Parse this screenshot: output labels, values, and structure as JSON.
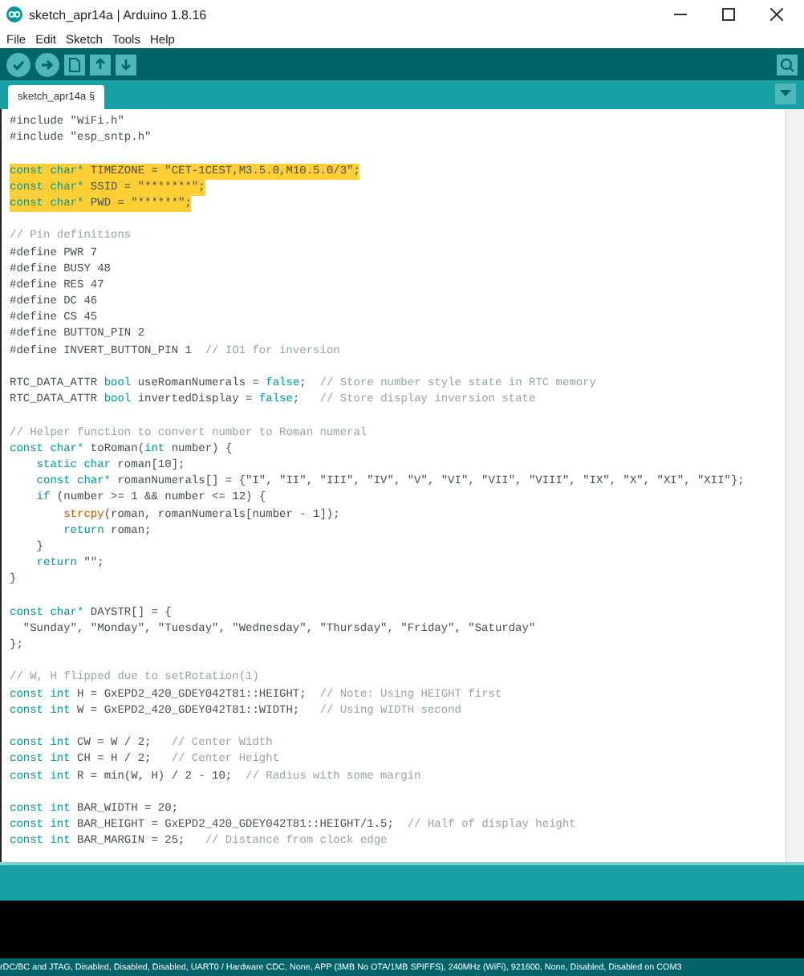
{
  "window": {
    "title": "sketch_apr14a | Arduino 1.8.16"
  },
  "menu": [
    "File",
    "Edit",
    "Sketch",
    "Tools",
    "Help"
  ],
  "tabs": [
    {
      "label": "sketch_apr14a §",
      "selected": true
    }
  ],
  "editor": {
    "lines": [
      {
        "kind": "code",
        "highlighted": false,
        "tokens": [
          {
            "kind": "plain",
            "text": "#include \"WiFi.h\""
          }
        ]
      },
      {
        "kind": "code",
        "highlighted": false,
        "tokens": [
          {
            "kind": "plain",
            "text": "#include \"esp_sntp.h\""
          }
        ]
      },
      {
        "kind": "blank"
      },
      {
        "kind": "code",
        "highlighted": true,
        "tokens": [
          {
            "kind": "keyword",
            "text": "const char*"
          },
          {
            "kind": "plain",
            "text": " TIMEZONE = \"CET-1CEST,M3.5.0,M10.5.0/3\";"
          }
        ]
      },
      {
        "kind": "code",
        "highlighted": true,
        "tokens": [
          {
            "kind": "keyword",
            "text": "const char*"
          },
          {
            "kind": "plain",
            "text": " SSID = \"*******\";"
          }
        ]
      },
      {
        "kind": "code",
        "highlighted": true,
        "tokens": [
          {
            "kind": "keyword",
            "text": "const char*"
          },
          {
            "kind": "plain",
            "text": " PWD = \"******\";"
          }
        ]
      },
      {
        "kind": "blank"
      },
      {
        "kind": "code",
        "highlighted": false,
        "tokens": [
          {
            "kind": "comment",
            "text": "// Pin definitions"
          }
        ]
      },
      {
        "kind": "code",
        "highlighted": false,
        "tokens": [
          {
            "kind": "plain",
            "text": "#define PWR 7"
          }
        ]
      },
      {
        "kind": "code",
        "highlighted": false,
        "tokens": [
          {
            "kind": "plain",
            "text": "#define BUSY 48"
          }
        ]
      },
      {
        "kind": "code",
        "highlighted": false,
        "tokens": [
          {
            "kind": "plain",
            "text": "#define RES 47"
          }
        ]
      },
      {
        "kind": "code",
        "highlighted": false,
        "tokens": [
          {
            "kind": "plain",
            "text": "#define DC 46"
          }
        ]
      },
      {
        "kind": "code",
        "highlighted": false,
        "tokens": [
          {
            "kind": "plain",
            "text": "#define CS 45"
          }
        ]
      },
      {
        "kind": "code",
        "highlighted": false,
        "tokens": [
          {
            "kind": "plain",
            "text": "#define BUTTON_PIN 2"
          }
        ]
      },
      {
        "kind": "code",
        "highlighted": false,
        "tokens": [
          {
            "kind": "plain",
            "text": "#define INVERT_BUTTON_PIN 1  "
          },
          {
            "kind": "comment",
            "text": "// IO1 for inversion"
          }
        ]
      },
      {
        "kind": "blank"
      },
      {
        "kind": "code",
        "highlighted": false,
        "tokens": [
          {
            "kind": "plain",
            "text": "RTC_DATA_ATTR "
          },
          {
            "kind": "keyword",
            "text": "bool"
          },
          {
            "kind": "plain",
            "text": " useRomanNumerals = "
          },
          {
            "kind": "keyword",
            "text": "false"
          },
          {
            "kind": "plain",
            "text": ";  "
          },
          {
            "kind": "comment",
            "text": "// Store number style state in RTC memory"
          }
        ]
      },
      {
        "kind": "code",
        "highlighted": false,
        "tokens": [
          {
            "kind": "plain",
            "text": "RTC_DATA_ATTR "
          },
          {
            "kind": "keyword",
            "text": "bool"
          },
          {
            "kind": "plain",
            "text": " invertedDisplay = "
          },
          {
            "kind": "keyword",
            "text": "false"
          },
          {
            "kind": "plain",
            "text": ";   "
          },
          {
            "kind": "comment",
            "text": "// Store display inversion state"
          }
        ]
      },
      {
        "kind": "blank"
      },
      {
        "kind": "code",
        "highlighted": false,
        "tokens": [
          {
            "kind": "comment",
            "text": "// Helper function to convert number to Roman numeral"
          }
        ]
      },
      {
        "kind": "code",
        "highlighted": false,
        "tokens": [
          {
            "kind": "keyword",
            "text": "const char*"
          },
          {
            "kind": "plain",
            "text": " toRoman("
          },
          {
            "kind": "keyword",
            "text": "int"
          },
          {
            "kind": "plain",
            "text": " number) {"
          }
        ]
      },
      {
        "kind": "code",
        "highlighted": false,
        "tokens": [
          {
            "kind": "keyword",
            "text": "    static char"
          },
          {
            "kind": "plain",
            "text": " roman[10];"
          }
        ]
      },
      {
        "kind": "code",
        "highlighted": false,
        "tokens": [
          {
            "kind": "keyword",
            "text": "    const char*"
          },
          {
            "kind": "plain",
            "text": " romanNumerals[] = {\"I\", \"II\", \"III\", \"IV\", \"V\", \"VI\", \"VII\", \"VIII\", \"IX\", \"X\", \"XI\", \"XII\"};"
          }
        ]
      },
      {
        "kind": "code",
        "highlighted": false,
        "tokens": [
          {
            "kind": "keyword",
            "text": "    if"
          },
          {
            "kind": "plain",
            "text": " (number >= 1 && number <= 12) {"
          }
        ]
      },
      {
        "kind": "code",
        "highlighted": false,
        "tokens": [
          {
            "kind": "function",
            "text": "        strcpy"
          },
          {
            "kind": "plain",
            "text": "(roman, romanNumerals[number - 1]);"
          }
        ]
      },
      {
        "kind": "code",
        "highlighted": false,
        "tokens": [
          {
            "kind": "keyword",
            "text": "        return"
          },
          {
            "kind": "plain",
            "text": " roman;"
          }
        ]
      },
      {
        "kind": "code",
        "highlighted": false,
        "tokens": [
          {
            "kind": "plain",
            "text": "    }"
          }
        ]
      },
      {
        "kind": "code",
        "highlighted": false,
        "tokens": [
          {
            "kind": "keyword",
            "text": "    return"
          },
          {
            "kind": "plain",
            "text": " \"\";"
          }
        ]
      },
      {
        "kind": "code",
        "highlighted": false,
        "tokens": [
          {
            "kind": "plain",
            "text": "}"
          }
        ]
      },
      {
        "kind": "blank"
      },
      {
        "kind": "code",
        "highlighted": false,
        "tokens": [
          {
            "kind": "keyword",
            "text": "const char*"
          },
          {
            "kind": "plain",
            "text": " DAYSTR[] = {"
          }
        ]
      },
      {
        "kind": "code",
        "highlighted": false,
        "tokens": [
          {
            "kind": "plain",
            "text": "  \"Sunday\", \"Monday\", \"Tuesday\", \"Wednesday\", \"Thursday\", \"Friday\", \"Saturday\""
          }
        ]
      },
      {
        "kind": "code",
        "highlighted": false,
        "tokens": [
          {
            "kind": "plain",
            "text": "};"
          }
        ]
      },
      {
        "kind": "blank"
      },
      {
        "kind": "code",
        "highlighted": false,
        "tokens": [
          {
            "kind": "comment",
            "text": "// W, H flipped due to setRotation(1)"
          }
        ]
      },
      {
        "kind": "code",
        "highlighted": false,
        "tokens": [
          {
            "kind": "keyword",
            "text": "const int"
          },
          {
            "kind": "plain",
            "text": " H = GxEPD2_420_GDEY042T81::HEIGHT;  "
          },
          {
            "kind": "comment",
            "text": "// Note: Using HEIGHT first"
          }
        ]
      },
      {
        "kind": "code",
        "highlighted": false,
        "tokens": [
          {
            "kind": "keyword",
            "text": "const int"
          },
          {
            "kind": "plain",
            "text": " W = GxEPD2_420_GDEY042T81::WIDTH;   "
          },
          {
            "kind": "comment",
            "text": "// Using WIDTH second"
          }
        ]
      },
      {
        "kind": "blank"
      },
      {
        "kind": "code",
        "highlighted": false,
        "tokens": [
          {
            "kind": "keyword",
            "text": "const int"
          },
          {
            "kind": "plain",
            "text": " CW = W / 2;   "
          },
          {
            "kind": "comment",
            "text": "// Center Width"
          }
        ]
      },
      {
        "kind": "code",
        "highlighted": false,
        "tokens": [
          {
            "kind": "keyword",
            "text": "const int"
          },
          {
            "kind": "plain",
            "text": " CH = H / 2;   "
          },
          {
            "kind": "comment",
            "text": "// Center Height"
          }
        ]
      },
      {
        "kind": "code",
        "highlighted": false,
        "tokens": [
          {
            "kind": "keyword",
            "text": "const int"
          },
          {
            "kind": "plain",
            "text": " R = min(W, H) / 2 - 10;  "
          },
          {
            "kind": "comment",
            "text": "// Radius with some margin"
          }
        ]
      },
      {
        "kind": "blank"
      },
      {
        "kind": "code",
        "highlighted": false,
        "tokens": [
          {
            "kind": "keyword",
            "text": "const int"
          },
          {
            "kind": "plain",
            "text": " BAR_WIDTH = 20;"
          }
        ]
      },
      {
        "kind": "code",
        "highlighted": false,
        "tokens": [
          {
            "kind": "keyword",
            "text": "const int"
          },
          {
            "kind": "plain",
            "text": " BAR_HEIGHT = GxEPD2_420_GDEY042T81::HEIGHT/1.5;  "
          },
          {
            "kind": "comment",
            "text": "// Half of display height"
          }
        ]
      },
      {
        "kind": "code",
        "highlighted": false,
        "tokens": [
          {
            "kind": "keyword",
            "text": "const int"
          },
          {
            "kind": "plain",
            "text": " BAR_MARGIN = 25;   "
          },
          {
            "kind": "comment",
            "text": "// Distance from clock edge"
          }
        ]
      }
    ]
  },
  "status_bar": "rDC/BC and JTAG, Disabled, Disabled, Disabled, UART0 / Hardware CDC, None, APP (3MB No OTA/1MB SPIFFS), 240MHz (WiFi), 921600, None, Disabled, Disabled on COM3"
}
